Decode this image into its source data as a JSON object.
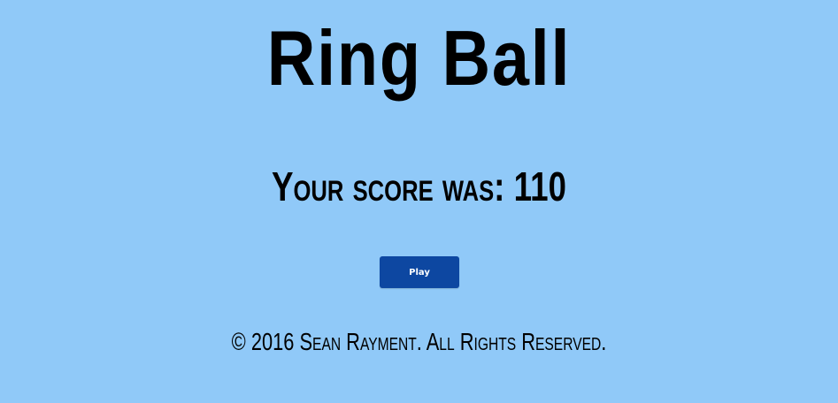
{
  "game": {
    "title": "Ring Ball",
    "score_text": "Your score was: 110",
    "play_button_label": "Play",
    "footer_text": "© 2016 Sean Rayment. All Rights Reserved."
  },
  "colors": {
    "background": "#90c9f8",
    "button": "#0d47a1",
    "text": "#000000",
    "button_text": "#ffffff"
  }
}
